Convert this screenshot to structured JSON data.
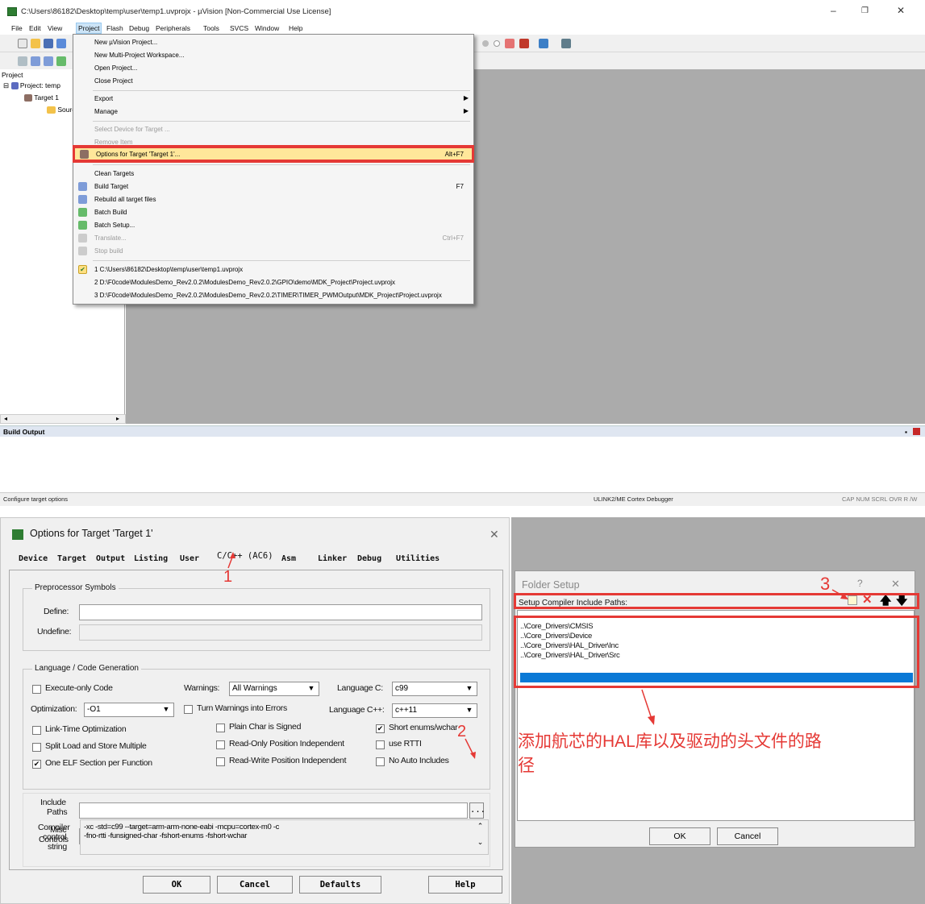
{
  "uvision": {
    "title": "C:\\Users\\86182\\Desktop\\temp\\user\\temp1.uvprojx - µVision  [Non-Commercial Use License]",
    "window_controls": [
      "–",
      "❐",
      "✕"
    ],
    "menubar": [
      "File",
      "Edit",
      "View",
      "Project",
      "Flash",
      "Debug",
      "Peripherals",
      "Tools",
      "SVCS",
      "Window",
      "Help"
    ],
    "project_panel": {
      "header": "Project",
      "tree": [
        "Project: temp",
        "Target 1",
        "Sourc"
      ]
    },
    "project_menu": {
      "items": [
        {
          "label": "New µVision Project...",
          "shortcut": "",
          "state": "normal"
        },
        {
          "label": "New Multi-Project Workspace...",
          "shortcut": "",
          "state": "normal"
        },
        {
          "label": "Open Project...",
          "shortcut": "",
          "state": "normal"
        },
        {
          "label": "Close Project",
          "shortcut": "",
          "state": "normal"
        },
        {
          "label": "Export",
          "shortcut": "",
          "state": "submenu"
        },
        {
          "label": "Manage",
          "shortcut": "",
          "state": "submenu"
        },
        {
          "label": "Select Device for Target ...",
          "shortcut": "",
          "state": "disabled"
        },
        {
          "label": "Remove Item",
          "shortcut": "",
          "state": "disabled"
        },
        {
          "label": "Options for Target 'Target 1'...",
          "shortcut": "Alt+F7",
          "state": "highlighted"
        },
        {
          "label": "Clean Targets",
          "shortcut": "",
          "state": "normal"
        },
        {
          "label": "Build Target",
          "shortcut": "F7",
          "state": "normal"
        },
        {
          "label": "Rebuild all target files",
          "shortcut": "",
          "state": "normal"
        },
        {
          "label": "Batch Build",
          "shortcut": "",
          "state": "normal"
        },
        {
          "label": "Batch Setup...",
          "shortcut": "",
          "state": "normal"
        },
        {
          "label": "Translate...",
          "shortcut": "Ctrl+F7",
          "state": "disabled"
        },
        {
          "label": "Stop build",
          "shortcut": "",
          "state": "disabled"
        },
        {
          "label": "1 C:\\Users\\86182\\Desktop\\temp\\user\\temp1.uvprojx",
          "shortcut": "",
          "state": "checked"
        },
        {
          "label": "2 D:\\F0code\\ModulesDemo_Rev2.0.2\\ModulesDemo_Rev2.0.2\\GPIO\\demo\\MDK_Project\\Project.uvprojx",
          "shortcut": "",
          "state": "normal"
        },
        {
          "label": "3 D:\\F0code\\ModulesDemo_Rev2.0.2\\ModulesDemo_Rev2.0.2\\TIMER\\TIMER_PWMOutput\\MDK_Project\\Project.uvprojx",
          "shortcut": "",
          "state": "normal"
        }
      ]
    },
    "build_output_header": "Build Output",
    "status": {
      "left": "Configure target options",
      "debugger": "ULINK2/ME Cortex Debugger",
      "indicators": "CAP  NUM  SCRL  OVR  R /W"
    }
  },
  "options_dialog": {
    "title": "Options for Target 'Target 1'",
    "close": "✕",
    "tabs": [
      "Device",
      "Target",
      "Output",
      "Listing",
      "User",
      "C/C++ (AC6)",
      "Asm",
      "Linker",
      "Debug",
      "Utilities"
    ],
    "preprocessor": {
      "group": "Preprocessor Symbols",
      "define_label": "Define:",
      "define_value": "",
      "undefine_label": "Undefine:",
      "undefine_value": ""
    },
    "language": {
      "group": "Language / Code Generation",
      "execute_only": "Execute-only Code",
      "warnings_label": "Warnings:",
      "warnings_value": "All Warnings",
      "language_c_label": "Language C:",
      "language_c_value": "c99",
      "optimization_label": "Optimization:",
      "optimization_value": "-O1",
      "turn_warnings": "Turn Warnings into Errors",
      "language_cpp_label": "Language C++:",
      "language_cpp_value": "c++11",
      "lto": "Link-Time Optimization",
      "plain_char": "Plain Char is Signed",
      "short_enums": "Short enums/wchar",
      "split_load": "Split Load and Store Multiple",
      "ropi": "Read-Only Position Independent",
      "rtti": "use RTTI",
      "one_elf": "One ELF Section per Function",
      "rwpi": "Read-Write Position Independent",
      "no_auto": "No Auto Includes"
    },
    "include_label": "Include\nPaths",
    "include_label_1": "Include",
    "include_label_2": "Paths",
    "browse": "...",
    "misc_label_1": "Misc",
    "misc_label_2": "Controls",
    "compiler_label_1": "Compiler",
    "compiler_label_2": "control",
    "compiler_label_3": "string",
    "compiler_line_1": "-xc -std=c99 --target=arm-arm-none-eabi -mcpu=cortex-m0 -c",
    "compiler_line_2": "-fno-rtti -funsigned-char -fshort-enums -fshort-wchar",
    "buttons": {
      "ok": "OK",
      "cancel": "Cancel",
      "defaults": "Defaults",
      "help": "Help"
    }
  },
  "folder_setup": {
    "title": "Folder Setup",
    "help": "?",
    "close": "✕",
    "label": "Setup Compiler Include Paths:",
    "paths": [
      "..\\Core_Drivers\\CMSIS",
      "..\\Core_Drivers\\Device",
      "..\\Core_Drivers\\HAL_Driver\\Inc",
      "..\\Core_Drivers\\HAL_Driver\\Src"
    ],
    "buttons": {
      "ok": "OK",
      "cancel": "Cancel"
    }
  },
  "annotations": {
    "step1": "1",
    "step2": "2",
    "step3": "3",
    "note": "添加航芯的HAL库以及驱动的头文件的路径",
    "note_line1": "添加航芯的HAL库以及驱动的头文件的路",
    "note_line2": "径"
  },
  "colors": {
    "highlight_red": "#e53935",
    "menu_highlight": "#ffe79a",
    "selection_blue": "#0a79d6",
    "workspace_gray": "#ababab"
  }
}
